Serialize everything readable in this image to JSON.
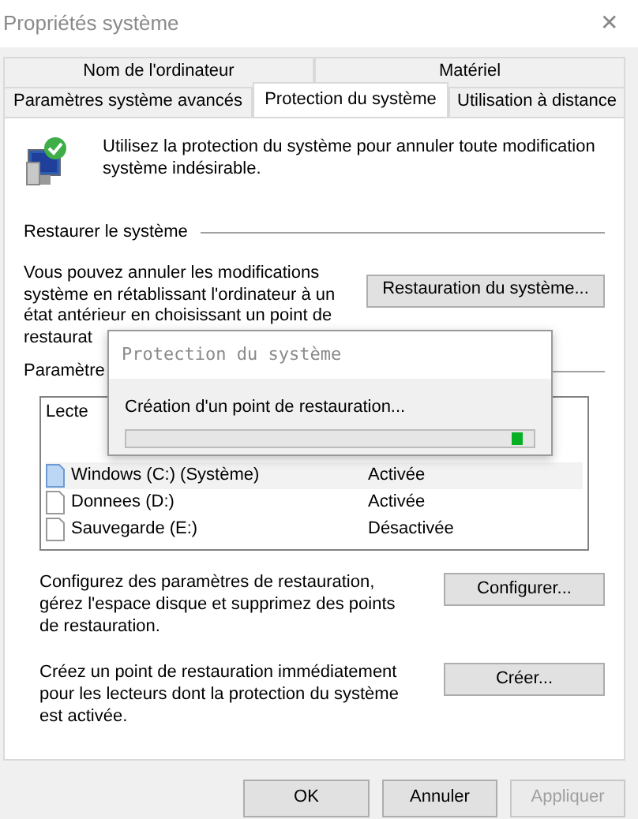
{
  "window": {
    "title": "Propriétés système",
    "close": "✕"
  },
  "tab_rows": [
    [
      {
        "label": "Nom de l'ordinateur",
        "selected": false
      },
      {
        "label": "Matériel",
        "selected": false
      }
    ],
    [
      {
        "label": "Paramètres système avancés",
        "selected": false
      },
      {
        "label": "Protection du système",
        "selected": true
      },
      {
        "label": "Utilisation à distance",
        "selected": false
      }
    ]
  ],
  "intro": "Utilisez la protection du système pour annuler toute modification système indésirable.",
  "restore": {
    "heading": "Restaurer le système",
    "text": "Vous pouvez annuler les modifications système en rétablissant l'ordinateur à un état antérieur en choisissant un point de",
    "text_cut": "restaurat",
    "button": "Restauration du système..."
  },
  "settings": {
    "heading": "Paramètre",
    "column_1": "Lecte",
    "drives": [
      {
        "name": "Windows (C:) (Système)",
        "status": "Activée",
        "selected": true
      },
      {
        "name": "Donnees (D:)",
        "status": "Activée",
        "selected": false
      },
      {
        "name": "Sauvegarde (E:)",
        "status": "Désactivée",
        "selected": false
      }
    ]
  },
  "actions": [
    {
      "text": "Configurez des paramètres de restauration, gérez l'espace disque et supprimez des points de restauration.",
      "button": "Configurer..."
    },
    {
      "text": "Créez un point de restauration immédiatement pour les lecteurs dont la protection du système est activée.",
      "button": "Créer..."
    }
  ],
  "progress_dialog": {
    "title": "Protection du système",
    "message": "Création d'un point de restauration...",
    "level": 0.98
  },
  "buttons": [
    {
      "label": "OK",
      "disabled": false
    },
    {
      "label": "Annuler",
      "disabled": false
    },
    {
      "label": "Appliquer",
      "disabled": true
    }
  ]
}
